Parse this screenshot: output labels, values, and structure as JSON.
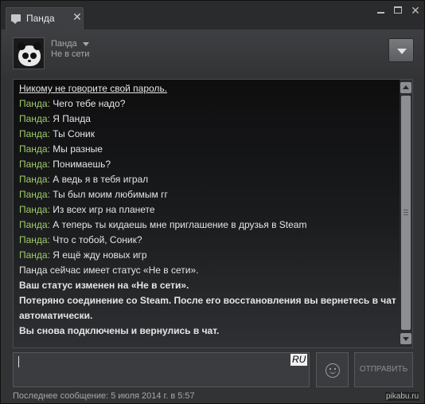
{
  "window": {
    "tab_title": "Панда",
    "close_glyph": "✕"
  },
  "header": {
    "friend_name": "Панда",
    "friend_status": "Не в сети"
  },
  "chat": {
    "system_warning": "Никому не говорите свой пароль.",
    "messages": [
      {
        "who": "Панда:",
        "text": "Чего тебе надо?"
      },
      {
        "who": "Панда:",
        "text": "Я Панда"
      },
      {
        "who": "Панда:",
        "text": "Ты Соник"
      },
      {
        "who": "Панда:",
        "text": "Мы разные"
      },
      {
        "who": "Панда:",
        "text": "Понимаешь?"
      },
      {
        "who": "Панда:",
        "text": "А ведь я в тебя играл"
      },
      {
        "who": "Панда:",
        "text": "Ты был моим любимым гг"
      },
      {
        "who": "Панда:",
        "text": "Из всех игр на планете"
      },
      {
        "who": "Панда:",
        "text": "А теперь ты кидаешь мне приглашение в друзья в Steam"
      },
      {
        "who": "Панда:",
        "text": "Что с тобой, Соник?"
      },
      {
        "who": "Панда:",
        "text": "Я ещё жду новых игр"
      }
    ],
    "status_line": "Панда сейчас имеет статус «Не в сети».",
    "notices": [
      "Ваш статус изменен на «Не в сети».",
      "Потеряно соединение со Steam. После его восстановления вы вернетесь в чат автоматически.",
      "Вы снова подключены и вернулись в чат."
    ]
  },
  "input": {
    "language_indicator": "RU",
    "send_label": "ОТПРАВИТЬ"
  },
  "footer": {
    "last_message": "Последнее сообщение: 5 июля 2014 г. в 5:57"
  },
  "watermark": "pikabu.ru",
  "colors": {
    "sender_name": "#9fcb6a",
    "message_text": "#e5e5e5",
    "window_bg": "#323335"
  },
  "icons": [
    "chat-icon",
    "close-icon",
    "minimize-icon",
    "maximize-icon",
    "window-close-icon",
    "chevron-down-icon",
    "emoji-icon"
  ]
}
